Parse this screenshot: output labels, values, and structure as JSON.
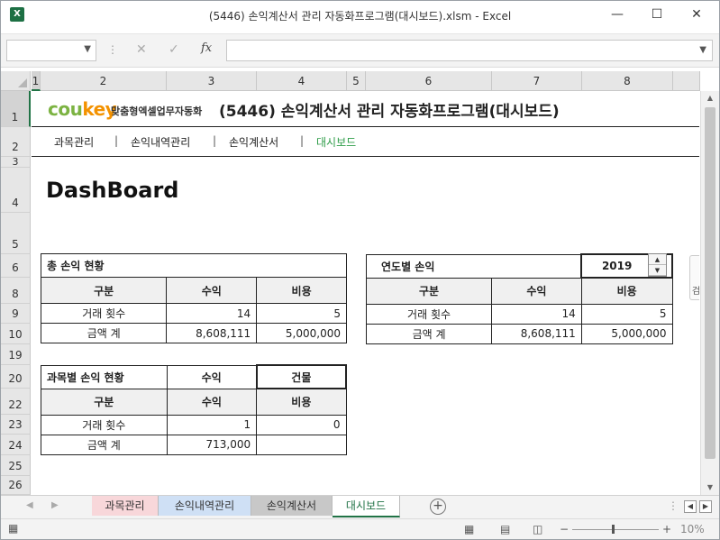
{
  "window": {
    "app_icon": "X",
    "title": "(5446) 손익계산서 관리 자동화프로그램(대시보드).xlsm  -  Excel",
    "minimize": "—",
    "maximize": "☐",
    "close": "✕"
  },
  "formula_bar": {
    "name_box": "",
    "cancel": "✕",
    "enter": "✓",
    "fx": "fx",
    "content": ""
  },
  "columns": [
    "1",
    "2",
    "3",
    "4",
    "5",
    "6",
    "7",
    "8"
  ],
  "rows": [
    "1",
    "2",
    "3",
    "4",
    "5",
    "6",
    "8",
    "9",
    "10",
    "19",
    "20",
    "22",
    "23",
    "24",
    "25",
    "26"
  ],
  "header": {
    "logo_cou": "cou",
    "logo_key": "key",
    "logo_sub": "맞춤형엑셀업무자동화",
    "title": "(5446) 손익계산서 관리 자동화프로그램(대시보드)"
  },
  "nav": {
    "items": [
      "과목관리",
      "손익내역관리",
      "손익계산서",
      "대시보드"
    ],
    "separator": "|"
  },
  "dashboard_title": "DashBoard",
  "total": {
    "title": "총 손익 현황",
    "headers": [
      "구분",
      "수익",
      "비용"
    ],
    "rows": [
      [
        "거래 횟수",
        "14",
        "5"
      ],
      [
        "금액 계",
        "8,608,111",
        "5,000,000"
      ]
    ]
  },
  "yearly": {
    "title": "연도별 손익",
    "year": "2019",
    "spin_up": "▲",
    "spin_down": "▼",
    "headers": [
      "구분",
      "수익",
      "비용"
    ],
    "rows": [
      [
        "거래 횟수",
        "14",
        "5"
      ],
      [
        "금액 계",
        "8,608,111",
        "5,000,000"
      ]
    ]
  },
  "by_subject": {
    "title": "과목별 손익 현황",
    "type": "수익",
    "subject": "건물",
    "headers": [
      "구분",
      "수익",
      "비용"
    ],
    "rows": [
      [
        "거래 횟수",
        "1",
        "0"
      ],
      [
        "금액 계",
        "713,000",
        ""
      ]
    ]
  },
  "side_tab_label": "검",
  "sheet_tabs": [
    {
      "label": "과목관리",
      "color": "#f8d7da"
    },
    {
      "label": "손익내역관리",
      "color": "#cfe0f5"
    },
    {
      "label": "손익계산서",
      "color": "#c8c8c8"
    },
    {
      "label": "대시보드",
      "color": "#ffffff"
    }
  ],
  "add_sheet": "+",
  "status": {
    "zoom_minus": "−",
    "zoom_plus": "+",
    "zoom": "10%"
  },
  "colors": {
    "excel_green": "#217346",
    "active_nav": "#2e9c48",
    "logo_green": "#7cb342",
    "logo_orange": "#f39200"
  }
}
